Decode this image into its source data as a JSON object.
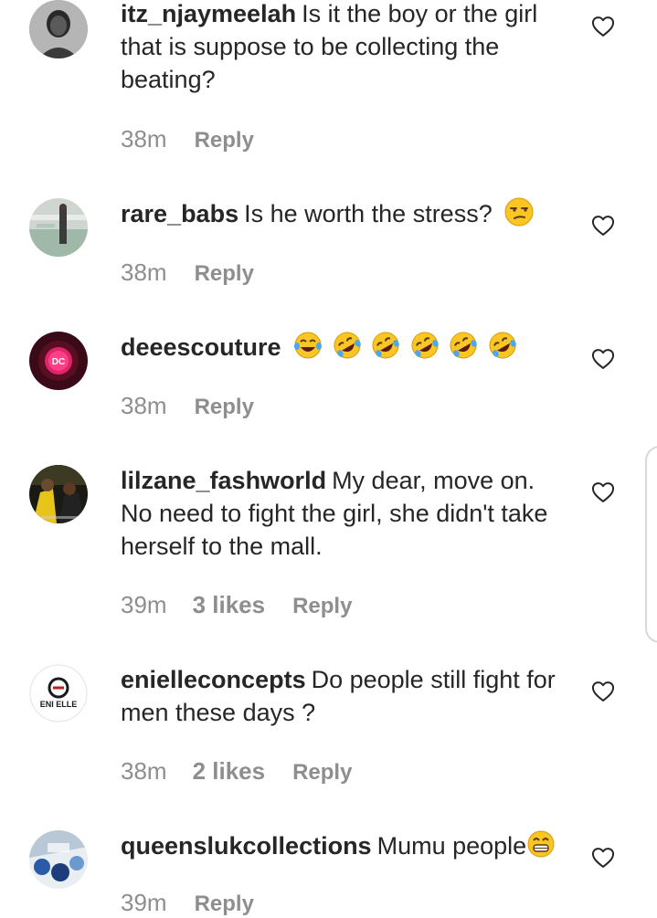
{
  "comments": [
    {
      "username": "itz_njaymeelah",
      "text": "Is it the boy or the girl that is suppose to be collecting the beating?",
      "time": "38m",
      "likes": "",
      "reply": "Reply"
    },
    {
      "username": "rare_babs",
      "text": "Is he worth the stress?",
      "emoji": [
        "unamused-face"
      ],
      "time": "38m",
      "likes": "",
      "reply": "Reply"
    },
    {
      "username": "deeescouture",
      "text": "",
      "emoji": [
        "face-with-tears-of-joy",
        "rolling-on-floor-laughing",
        "rolling-on-floor-laughing",
        "rolling-on-floor-laughing",
        "rolling-on-floor-laughing",
        "rolling-on-floor-laughing"
      ],
      "time": "38m",
      "likes": "",
      "reply": "Reply"
    },
    {
      "username": "lilzane_fashworld",
      "text": "My dear, move on. No need to fight the girl, she didn't take herself to the mall.",
      "time": "39m",
      "likes": "3 likes",
      "reply": "Reply"
    },
    {
      "username": "enielleconcepts",
      "text": "Do people still fight for men these days ?",
      "time": "38m",
      "likes": "2 likes",
      "reply": "Reply"
    },
    {
      "username": "queenslukcollections",
      "text": "Mumu people",
      "emoji": [
        "grinning-face"
      ],
      "time": "39m",
      "likes": "",
      "reply": "Reply"
    }
  ],
  "avatar_logos": {
    "deeescouture": "DC",
    "enielleconcepts": "ENI ELLE"
  },
  "colors": {
    "text": "#262626",
    "secondary": "#8e8e8e",
    "heart_outline": "#262626"
  },
  "icons": {
    "like": "heart-outline-icon"
  }
}
